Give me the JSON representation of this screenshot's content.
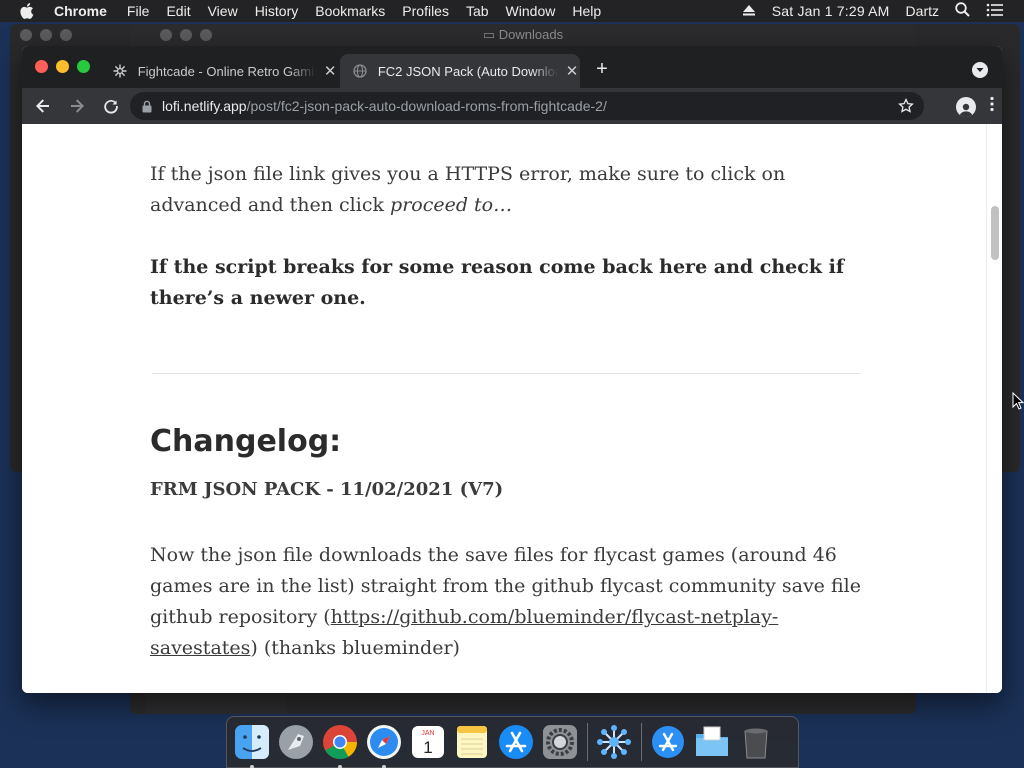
{
  "menubar": {
    "app_name": "Chrome",
    "menus": [
      "File",
      "Edit",
      "View",
      "History",
      "Bookmarks",
      "Profiles",
      "Tab",
      "Window",
      "Help"
    ],
    "datetime": "Sat Jan 1  7:29 AM",
    "user": "Dartz"
  },
  "background": {
    "folder_title": "Downloads"
  },
  "browser": {
    "tabs": [
      {
        "title": "Fightcade - Online Retro Gaming",
        "icon": "fightcade-logo-icon",
        "active": false
      },
      {
        "title": "FC2 JSON Pack (Auto Download",
        "icon": "globe-icon",
        "active": true
      }
    ],
    "url": {
      "host": "lofi.netlify.app",
      "path": "/post/fc2-json-pack-auto-download-roms-from-fightcade-2/"
    }
  },
  "article": {
    "p1_text": "If the json file link gives you a HTTPS error, make sure to click on advanced and then click ",
    "p1_emphasis": "proceed to…",
    "p2_text": "If the script breaks for some reason come back here and check if there’s a newer one.",
    "changelog_heading": "Changelog:",
    "version_heading": "FRM JSON PACK - 11/02/2021 (V7)",
    "p3_before": "Now the json file downloads the save files for flycast games (around 46 games are in the list) straight from the github flycast community save file github re­pository (",
    "p3_link": "https://github.com/blueminder/flycast-netplay-savestates",
    "p3_after": ") (thanks blueminder)"
  },
  "dock": {
    "items": [
      "finder-icon",
      "launchpad-icon",
      "chrome-icon",
      "safari-icon",
      "calendar-icon",
      "notes-icon",
      "app-store-icon",
      "system-preferences-icon",
      "network-utility-icon",
      "applications-folder-icon",
      "downloads-folder-icon",
      "trash-icon"
    ],
    "calendar_month": "JAN",
    "calendar_day": "1"
  }
}
